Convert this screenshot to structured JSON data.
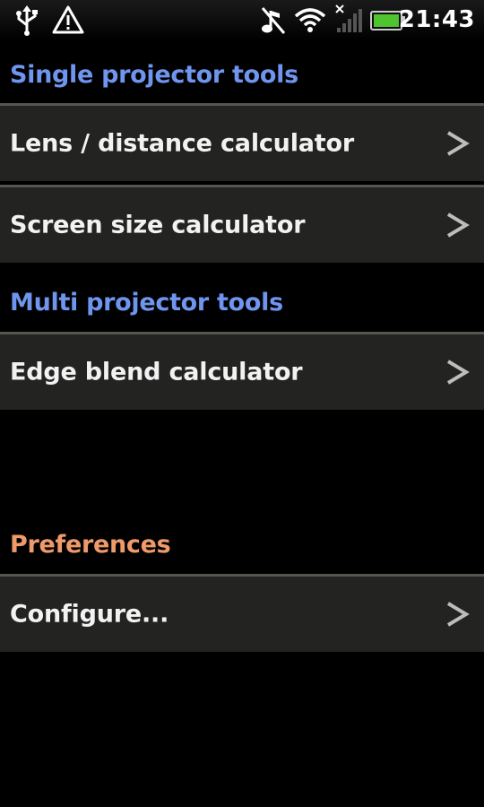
{
  "status_bar": {
    "time": "21:43",
    "icons": [
      "usb-icon",
      "warning-icon",
      "muted-notification-icon",
      "wifi-icon",
      "no-signal-icon",
      "battery-icon"
    ]
  },
  "colors": {
    "section_blue": "#6f95ee",
    "section_orange": "#ee9a6a",
    "item_background": "#232422",
    "item_divider": "#555650"
  },
  "sections": [
    {
      "header": "Single projector tools",
      "items": [
        {
          "label": "Lens / distance calculator"
        },
        {
          "label": "Screen size calculator"
        }
      ]
    },
    {
      "header": "Multi projector tools",
      "items": [
        {
          "label": "Edge blend calculator"
        }
      ]
    },
    {
      "header": "Preferences",
      "items": [
        {
          "label": "Configure..."
        }
      ]
    }
  ]
}
